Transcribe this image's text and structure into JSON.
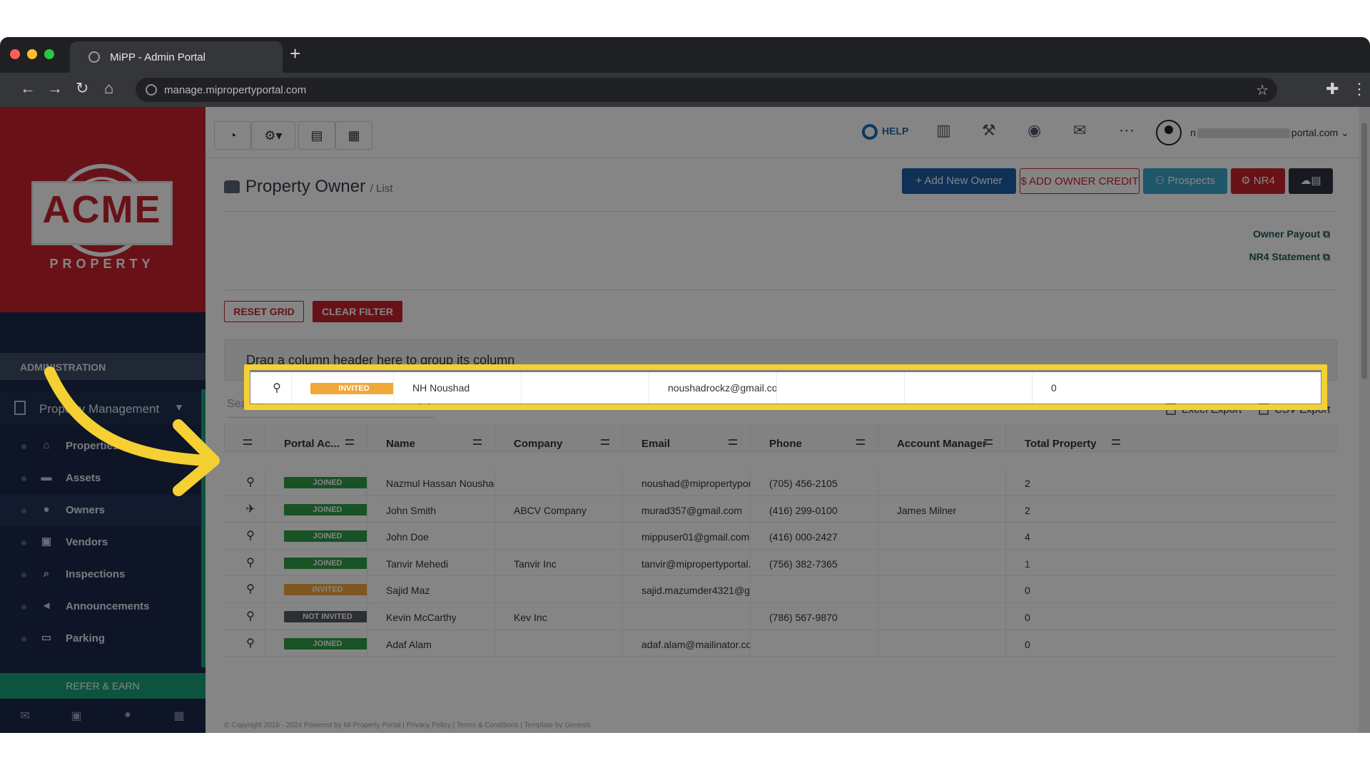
{
  "browser": {
    "tab_title": "MiPP - Admin Portal",
    "url": "manage.mipropertyportal.com",
    "icons": [
      "back-icon",
      "forward-icon",
      "reload-icon",
      "home-icon",
      "star-icon",
      "puzzle-icon",
      "kebab-icon"
    ]
  },
  "brand": {
    "logo_word": "ACME",
    "logo_sub": "PROPERTY",
    "primary_color": "#c8232c",
    "sidebar_color": "#1b2a4a",
    "accent_green": "#19a27a",
    "highlight_color": "#f5d033"
  },
  "sidebar": {
    "section": "ADMINISTRATION",
    "group": "Property Management",
    "items": [
      {
        "label": "Properties",
        "icon": "home-icon"
      },
      {
        "label": "Assets",
        "icon": "box-icon"
      },
      {
        "label": "Owners",
        "icon": "user-icon"
      },
      {
        "label": "Vendors",
        "icon": "briefcase-icon"
      },
      {
        "label": "Inspections",
        "icon": "magnifier-icon"
      },
      {
        "label": "Announcements",
        "icon": "megaphone-icon"
      },
      {
        "label": "Parking",
        "icon": "car-icon"
      }
    ],
    "refer": "REFER & EARN"
  },
  "topbar": {
    "help": "HELP",
    "user_prefix": "n",
    "user_suffix": "portal.com",
    "icons": [
      "dashboard-icon",
      "settings-icon",
      "calendar-icon",
      "calculator-icon",
      "chart-icon",
      "wrench-icon",
      "eye-icon",
      "mail-icon",
      "more-icon"
    ]
  },
  "page": {
    "title": "Property Owner",
    "subtitle": "/ List",
    "actions": {
      "add_owner": "+ Add New Owner",
      "add_credit": "$ ADD OWNER CREDIT",
      "prospects": "Prospects",
      "nr4": "NR4"
    },
    "links": {
      "owner_payout": "Owner Payout",
      "nr4_statement": "NR4 Statement"
    },
    "reset_grid": "RESET GRID",
    "clear_filter": "CLEAR FILTER",
    "group_hint": "Drag a column header here to group its column",
    "search_placeholder": "Search",
    "excel_export": "Excel Export",
    "csv_export": "CSV Export",
    "footer": "© Copyright 2016 - 2024 Powered by Mi Property Portal | Privacy Policy | Terms & Conditions | Template by Genesis"
  },
  "grid": {
    "headers": [
      "Portal Ac...",
      "Name",
      "Company",
      "Email",
      "Phone",
      "Account Manager",
      "Total Property"
    ],
    "highlighted": {
      "status": "INVITED",
      "name": "NH Noushad",
      "company": "",
      "email": "noushadrockz@gmail.com",
      "phone": "",
      "manager": "",
      "total": "0"
    },
    "rows": [
      {
        "status": "JOINED",
        "name": "Nazmul Hassan Noushad",
        "company": "",
        "email": "noushad@mipropertypor...",
        "phone": "(705) 456-2105",
        "manager": "",
        "total": "2"
      },
      {
        "status": "JOINED",
        "name": "John Smith",
        "company": "ABCV Company",
        "email": "murad357@gmail.com",
        "phone": "(416) 299-0100",
        "manager": "James Milner",
        "total": "2"
      },
      {
        "status": "JOINED",
        "name": "John Doe",
        "company": "",
        "email": "mippuser01@gmail.com",
        "phone": "(416) 000-2427",
        "manager": "",
        "total": "4"
      },
      {
        "status": "JOINED",
        "name": "Tanvir Mehedi",
        "company": "Tanvir Inc",
        "email": "tanvir@mipropertyportal....",
        "phone": "(756) 382-7365",
        "manager": "",
        "total": "1"
      },
      {
        "status": "INVITED",
        "name": "Sajid Maz",
        "company": "",
        "email": "sajid.mazumder4321@g...",
        "phone": "",
        "manager": "",
        "total": "0"
      },
      {
        "status": "NOT INVITED",
        "name": "Kevin McCarthy",
        "company": "Kev Inc",
        "email": "",
        "phone": "(786) 567-9870",
        "manager": "",
        "total": "0"
      },
      {
        "status": "JOINED",
        "name": "Adaf Alam",
        "company": "",
        "email": "adaf.alam@mailinator.com",
        "phone": "",
        "manager": "",
        "total": "0"
      }
    ],
    "status_colors": {
      "JOINED": "#2f9e47",
      "INVITED": "#f0a73a",
      "NOT INVITED": "#555b66"
    }
  }
}
